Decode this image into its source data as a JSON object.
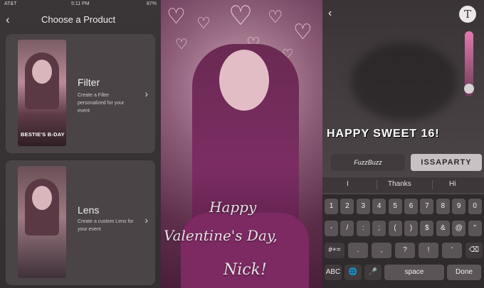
{
  "panel1": {
    "status": {
      "carrier": "AT&T",
      "time": "5:11 PM",
      "battery": "87%"
    },
    "title": "Choose a Product",
    "cards": [
      {
        "title": "Filter",
        "desc": "Create a Filter personalized for your event",
        "thumb_text": "BESTIE'S B-DAY"
      },
      {
        "title": "Lens",
        "desc": "Create a custom Lens for your event"
      }
    ]
  },
  "panel2": {
    "script_lines": [
      "Happy",
      "Valentine's Day,",
      "Nick!"
    ]
  },
  "panel3": {
    "entered_text": "HAPPY SWEET 16!",
    "font_options": [
      "FuzzBuzz",
      "ISSAPARTY"
    ],
    "suggestions": [
      "I",
      "Thanks",
      "Hi"
    ],
    "keyboard_rows": [
      [
        "1",
        "2",
        "3",
        "4",
        "5",
        "6",
        "7",
        "8",
        "9",
        "0"
      ],
      [
        "-",
        "/",
        ":",
        ";",
        "(",
        ")",
        "$",
        "&",
        "@",
        "\""
      ],
      [
        "#+=",
        ".",
        ",",
        "?",
        "!",
        "'",
        "⌫"
      ],
      [
        "ABC",
        "🌐",
        "🎤",
        "space",
        "Done"
      ]
    ]
  }
}
